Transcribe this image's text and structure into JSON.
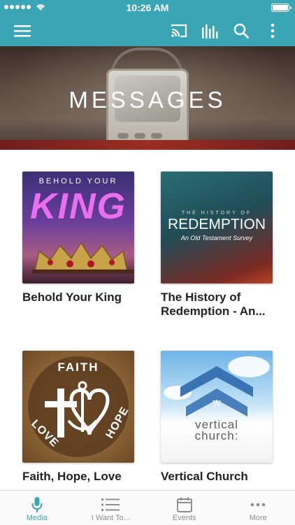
{
  "status_bar": {
    "time": "10:26 AM"
  },
  "app_bar": {
    "menu_icon": "hamburger-icon",
    "actions": [
      "cast-icon",
      "equalizer-icon",
      "search-icon",
      "more-vertical-icon"
    ]
  },
  "hero": {
    "title": "MESSAGES"
  },
  "series": [
    {
      "title": "Behold Your King",
      "art_top": "BEHOLD YOUR",
      "art_main": "KING"
    },
    {
      "title": "The History of Redemption - An...",
      "art_top": "THE HISTORY OF",
      "art_main": "REDEMPTION",
      "art_sub": "An Old Testament Survey"
    },
    {
      "title": "Faith, Hope, Love",
      "art_faith": "FAITH",
      "art_hope": "HOPE",
      "art_love": "LOVE"
    },
    {
      "title": "Vertical Church",
      "art_line1": "vertical",
      "art_line2": "church:"
    }
  ],
  "tabs": [
    {
      "label": "Media",
      "icon": "microphone-icon",
      "active": true
    },
    {
      "label": "I Want To...",
      "icon": "list-icon",
      "active": false
    },
    {
      "label": "Events",
      "icon": "calendar-icon",
      "active": false
    },
    {
      "label": "More",
      "icon": "more-horizontal-icon",
      "active": false
    }
  ],
  "colors": {
    "accent": "#3aa6b5",
    "inactive": "#8e8e8e"
  }
}
